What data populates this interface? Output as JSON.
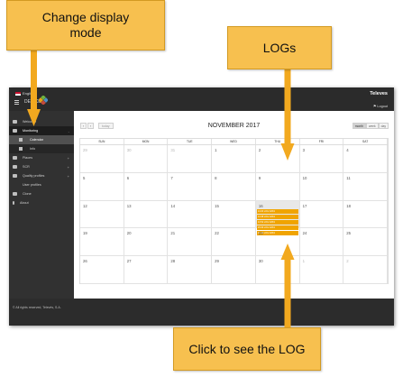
{
  "callouts": {
    "display_line1": "Change display",
    "display_line2": "mode",
    "logs": "LOGs",
    "click": "Click to see the LOG"
  },
  "topbar": {
    "language": "English",
    "app_title": "DEVICE",
    "brand": "Televes",
    "logout": "Logout"
  },
  "sidebar": {
    "items": [
      {
        "label": "Welcome",
        "icon": "monitor-icon"
      },
      {
        "label": "Monitoring",
        "icon": "chart-icon",
        "expand": "-"
      },
      {
        "label": "Places",
        "icon": "grid-icon",
        "expand": "+"
      },
      {
        "label": "SCR",
        "icon": "dish-icon",
        "expand": "+"
      },
      {
        "label": "Quality profiles",
        "icon": "people-icon",
        "expand": "+"
      },
      {
        "label": "User profiles",
        "icon": "user-icon"
      },
      {
        "label": "Clone",
        "icon": "clone-icon"
      },
      {
        "label": "About",
        "icon": "info-icon"
      }
    ],
    "sub_items": [
      {
        "label": "Calendar",
        "icon": "calendar-icon"
      },
      {
        "label": "Info",
        "icon": "list-icon"
      }
    ]
  },
  "calendar": {
    "prev": "‹",
    "next": "›",
    "today": "today",
    "title": "NOVEMBER 2017",
    "views": [
      "month",
      "week",
      "day"
    ],
    "active_view": "month",
    "weekdays": [
      "SUN",
      "MON",
      "TUE",
      "WED",
      "THU",
      "FRI",
      "SAT"
    ],
    "weeks": [
      [
        "29",
        "30",
        "31",
        "1",
        "2",
        "3",
        "4"
      ],
      [
        "5",
        "6",
        "7",
        "8",
        "9",
        "10",
        "11"
      ],
      [
        "12",
        "13",
        "14",
        "15",
        "16",
        "17",
        "18"
      ],
      [
        "19",
        "20",
        "21",
        "22",
        "23",
        "24",
        "25"
      ],
      [
        "26",
        "27",
        "28",
        "29",
        "30",
        "1",
        "2"
      ],
      [
        "3",
        "4",
        "5",
        "6",
        "7",
        "8",
        "9"
      ]
    ],
    "today_day": "16",
    "events": [
      "14:20 LOG DATA",
      "14:38 LOG DATA",
      "14:52 LOG DATA",
      "15:06 LOG DATA",
      "15:19 LOG DATA"
    ],
    "event_color": "#f0a400"
  },
  "footer": {
    "copyright": "© All rights reserved, Televés, S.A."
  },
  "colors": {
    "callout": "#f7c04f",
    "arrow": "#f2a91f"
  }
}
